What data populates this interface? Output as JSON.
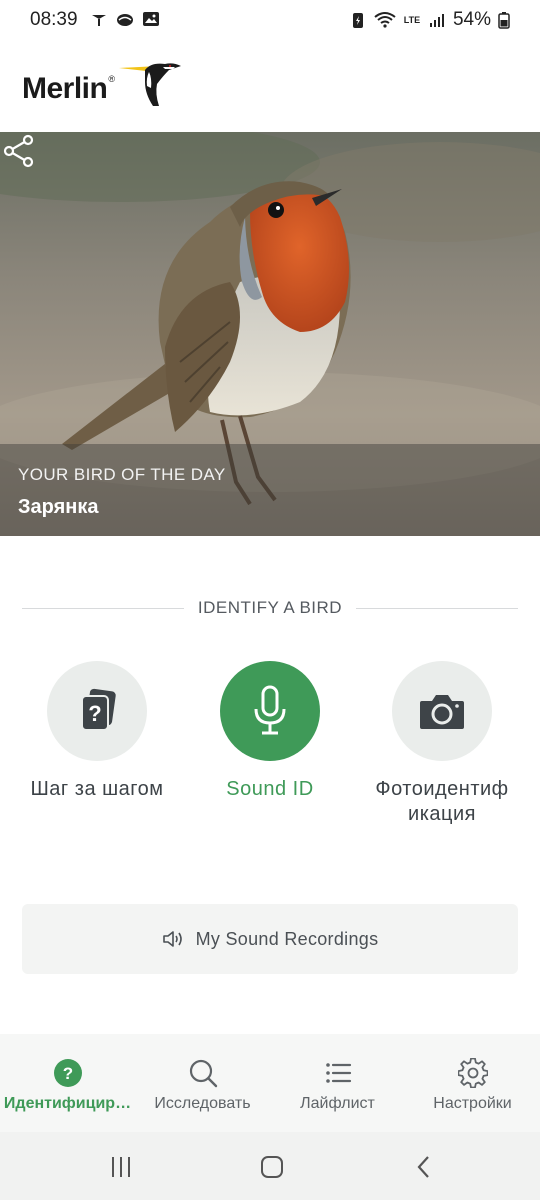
{
  "status_bar": {
    "time": "08:39",
    "battery": "54%",
    "network": "LTE"
  },
  "app": {
    "logo_text": "Merlin",
    "logo_reg": "®"
  },
  "bird_of_day": {
    "eyebrow": "YOUR BIRD OF THE DAY",
    "name": "Зарянка"
  },
  "identify": {
    "section_title": "IDENTIFY A BIRD",
    "options": [
      {
        "label": "Шаг за шагом",
        "icon": "question-cards-icon"
      },
      {
        "label": "Sound ID",
        "icon": "microphone-icon"
      },
      {
        "label": "Фотоидентиф икация",
        "label_line1": "Фотоидентиф",
        "label_line2": "икация",
        "icon": "camera-icon"
      }
    ]
  },
  "recordings": {
    "label": "My Sound Recordings",
    "icon": "speaker-icon"
  },
  "bottom_nav": {
    "items": [
      {
        "label": "Идентифицир…",
        "icon": "question-circle-icon",
        "active": true
      },
      {
        "label": "Исследовать",
        "icon": "search-icon",
        "active": false
      },
      {
        "label": "Лайфлист",
        "icon": "list-icon",
        "active": false
      },
      {
        "label": "Настройки",
        "icon": "gear-icon",
        "active": false
      }
    ]
  },
  "colors": {
    "accent": "#3f9a58",
    "option_bg": "#eaedeb",
    "nav_bg": "#f6f7f6"
  }
}
